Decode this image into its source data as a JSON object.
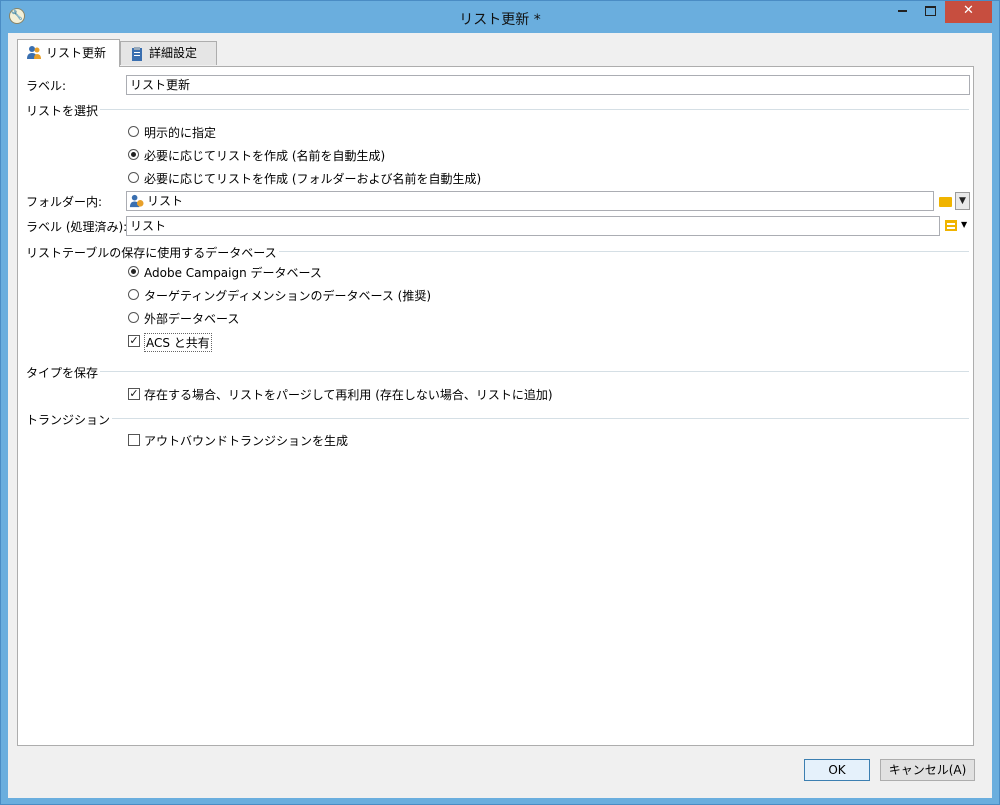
{
  "window": {
    "title": "リスト更新 *",
    "app_icon": "wrench-icon",
    "minimize": "minimize-icon",
    "maximize": "maximize-icon",
    "close": "close-icon"
  },
  "tabs": [
    {
      "label": "リスト更新",
      "icon": "users-icon",
      "active": true
    },
    {
      "label": "詳細設定",
      "icon": "clipboard-icon",
      "active": false
    }
  ],
  "form": {
    "label_caption": "ラベル:",
    "label_value": "リスト更新",
    "select_list_section": "リストを選択",
    "select_options": [
      {
        "label": "明示的に指定",
        "selected": false
      },
      {
        "label": "必要に応じてリストを作成 (名前を自動生成)",
        "selected": true
      },
      {
        "label": "必要に応じてリストを作成 (フォルダーおよび名前を自動生成)",
        "selected": false
      }
    ],
    "folder_caption": "フォルダー内:",
    "folder_value": "リスト",
    "processed_label_caption": "ラベル (処理済み):",
    "processed_label_value": "リスト",
    "db_section": "リストテーブルの保存に使用するデータベース",
    "db_options": [
      {
        "label": "Adobe Campaign データベース",
        "selected": true
      },
      {
        "label": "ターゲティングディメンションのデータベース (推奨)",
        "selected": false
      },
      {
        "label": "外部データベース",
        "selected": false
      }
    ],
    "share_acs": {
      "label": "ACS と共有",
      "checked": true
    },
    "save_type_section": "タイプを保存",
    "purge_reuse": {
      "label": "存在する場合、リストをパージして再利用 (存在しない場合、リストに追加)",
      "checked": true
    },
    "transition_section": "トランジション",
    "outbound_transition": {
      "label": "アウトバウンドトランジションを生成",
      "checked": false
    }
  },
  "buttons": {
    "ok": "OK",
    "cancel": "キャンセル(A)"
  },
  "colors": {
    "titlebar": "#6aaede",
    "close": "#c74e3f",
    "folder": "#f0b400"
  }
}
